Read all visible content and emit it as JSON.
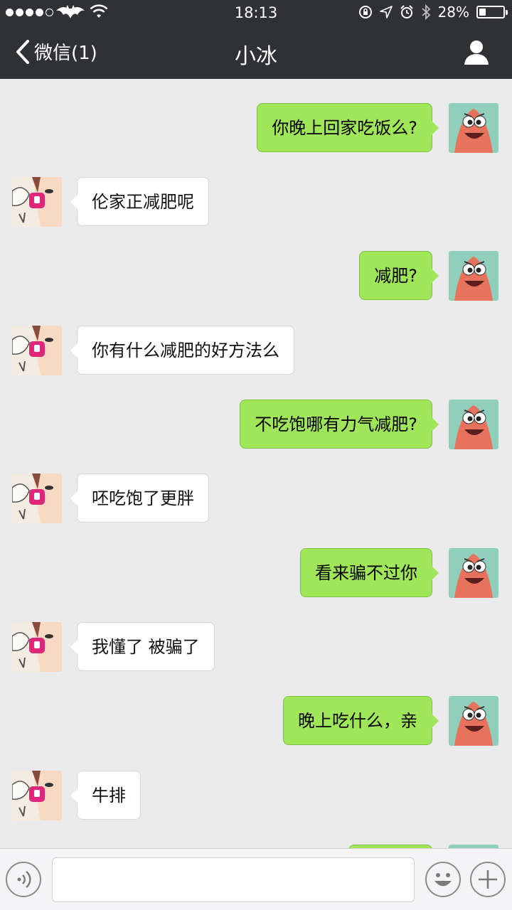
{
  "status_bar": {
    "time": "18:13",
    "battery": "28%",
    "battery_level": 0.28
  },
  "nav": {
    "back_label": "微信(1)",
    "title": "小冰"
  },
  "colors": {
    "header_bg": "#2f3134",
    "chat_bg": "#ebebeb",
    "my_bubble": "#9fe658",
    "their_bubble": "#ffffff"
  },
  "messages": [
    {
      "sender": "me",
      "text": "你晚上回家吃饭么?"
    },
    {
      "sender": "her",
      "text": "伦家正减肥呢"
    },
    {
      "sender": "me",
      "text": "减肥?"
    },
    {
      "sender": "her",
      "text": "你有什么减肥的好方法么"
    },
    {
      "sender": "me",
      "text": "不吃饱哪有力气减肥?"
    },
    {
      "sender": "her",
      "text": "呸吃饱了更胖"
    },
    {
      "sender": "me",
      "text": "看来骗不过你"
    },
    {
      "sender": "her",
      "text": "我懂了 被骗了"
    },
    {
      "sender": "me",
      "text": "晚上吃什么，亲"
    },
    {
      "sender": "her",
      "text": "牛排"
    }
  ],
  "input": {
    "value": ""
  }
}
